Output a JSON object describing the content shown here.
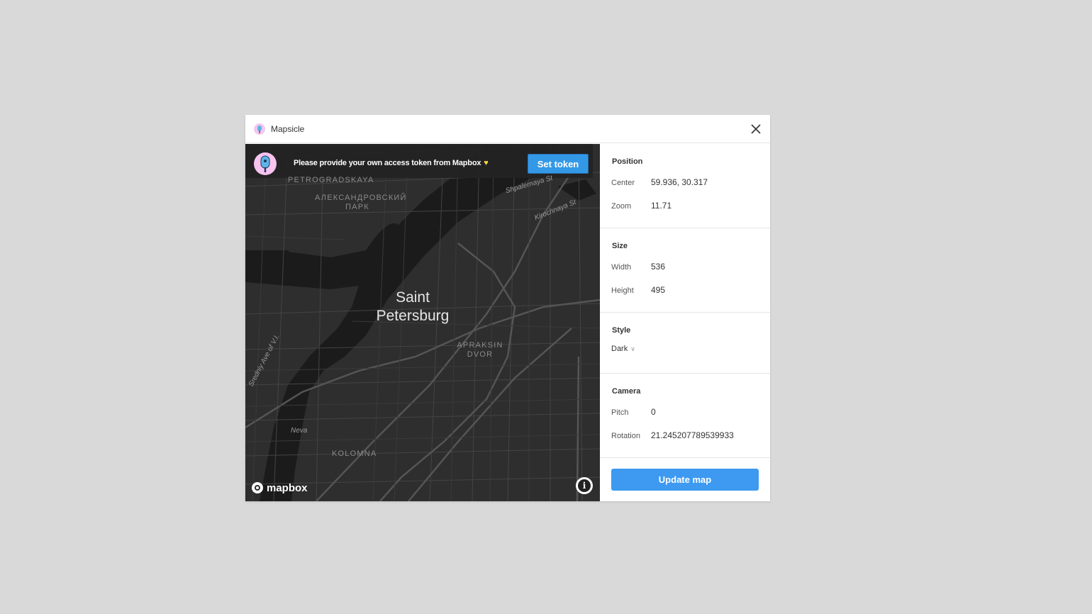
{
  "window": {
    "title": "Mapsicle",
    "icon": "popsicle-icon"
  },
  "banner": {
    "text": "Please provide your own access token from Mapbox",
    "heart": "♥",
    "button_label": "Set token"
  },
  "map": {
    "city": [
      "Saint",
      "Petersburg"
    ],
    "labels": {
      "petrogradskaya": "PETROGRADSKAYA",
      "park": [
        "АЛЕКСАНДРОВСКИЙ",
        "ПАРК"
      ],
      "apraksin": [
        "APRAKSIN",
        "DVOR"
      ],
      "kolomna": "KOLOMNA"
    },
    "streets": {
      "shpalernaya": "Shpalernaya St",
      "kirochnaya": "Kirochnaya St",
      "vo": "Sredniy Ave of V.I.",
      "neva": "Neva"
    },
    "attribution": "mapbox",
    "info": "i"
  },
  "panel": {
    "position": {
      "title": "Position",
      "center_label": "Center",
      "center_value": "59.936, 30.317",
      "zoom_label": "Zoom",
      "zoom_value": "11.71"
    },
    "size": {
      "title": "Size",
      "width_label": "Width",
      "width_value": "536",
      "height_label": "Height",
      "height_value": "495"
    },
    "style": {
      "title": "Style",
      "selected": "Dark",
      "chevron": "∨"
    },
    "camera": {
      "title": "Camera",
      "pitch_label": "Pitch",
      "pitch_value": "0",
      "rotation_label": "Rotation",
      "rotation_value": "21.245207789539933"
    },
    "update_label": "Update map"
  },
  "colors": {
    "accent": "#3d9af0",
    "map_bg": "#2e2e2e",
    "water": "#1c1c1c",
    "road": "#474747"
  }
}
